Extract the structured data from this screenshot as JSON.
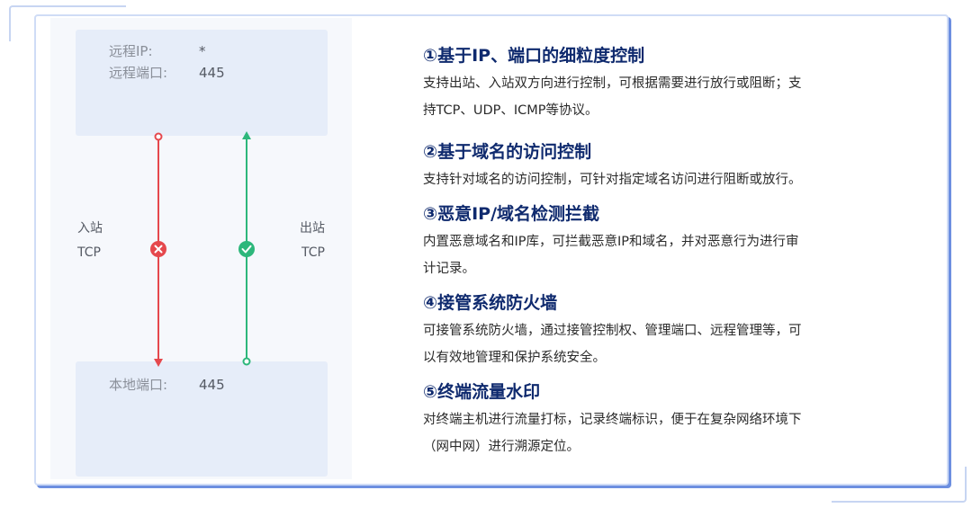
{
  "diagram": {
    "remote": {
      "ip_label": "远程IP:",
      "ip_value": "*",
      "port_label": "远程端口:",
      "port_value": "445"
    },
    "local": {
      "port_label": "本地端口:",
      "port_value": "445"
    },
    "inbound": {
      "label": "入站",
      "protocol": "TCP",
      "status": "blocked",
      "color": "#e5484d"
    },
    "outbound": {
      "label": "出站",
      "protocol": "TCP",
      "status": "allowed",
      "color": "#2db77b"
    }
  },
  "features": [
    {
      "title": "①基于IP、端口的细粒度控制",
      "lines": [
        "支持出站、入站双方向进行控制，可根据需要进行放行或阻断；支",
        "持TCP、UDP、ICMP等协议。"
      ]
    },
    {
      "title": "②基于域名的访问控制",
      "lines": [
        "支持针对域名的访问控制，可针对指定域名访问进行阻断或放行。"
      ]
    },
    {
      "title": "③恶意IP/域名检测拦截",
      "lines": [
        "内置恶意域名和IP库，可拦截恶意IP和域名，并对恶意行为进行审",
        "计记录。"
      ]
    },
    {
      "title": "④接管系统防火墙",
      "lines": [
        "可接管系统防火墙，通过接管控制权、管理端口、远程管理等，可",
        "以有效地管理和保护系统安全。"
      ]
    },
    {
      "title": "⑤终端流量水印",
      "lines": [
        "对终端主机进行流量打标，记录终端标识，便于在复杂网络环境下",
        "（网中网）进行溯源定位。"
      ]
    }
  ]
}
